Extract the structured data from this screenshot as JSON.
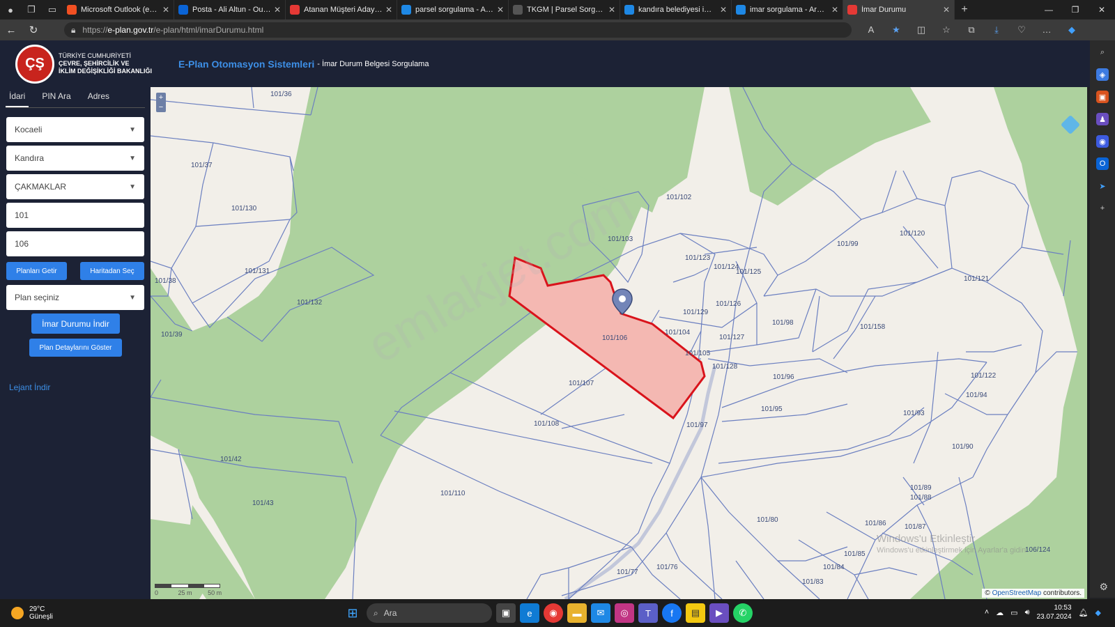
{
  "browser": {
    "tabs": [
      {
        "title": "Microsoft Outlook (eski a",
        "color": "#f25022"
      },
      {
        "title": "Posta - Ali Altun - Outlo",
        "color": "#0a64d6"
      },
      {
        "title": "Atanan Müşteri Adayları",
        "color": "#e53935"
      },
      {
        "title": "parsel sorgulama - Aram",
        "color": "#1e88e5"
      },
      {
        "title": "TKGM | Parsel Sorgu Uyg",
        "color": "#555555"
      },
      {
        "title": "kandıra belediyesi imar d",
        "color": "#1e88e5"
      },
      {
        "title": "imar sorgulama - Arama",
        "color": "#1e88e5"
      },
      {
        "title": "İmar Durumu",
        "color": "#e53935"
      }
    ],
    "url_prefix": "https://",
    "url_host": "e-plan.gov.tr",
    "url_path": "/e-plan/html/imarDurumu.html"
  },
  "header": {
    "ministry_line1": "TÜRKİYE CUMHURİYETİ",
    "ministry_line2": "ÇEVRE, ŞEHİRCİLİK VE",
    "ministry_line3": "İKLİM DEĞİŞİKLİĞİ BAKANLIĞI",
    "app_title": "E-Plan Otomasyon Sistemleri",
    "app_subtitle": " - İmar Durum Belgesi Sorgulama"
  },
  "panel": {
    "tabs": [
      "İdari",
      "PIN Ara",
      "Adres"
    ],
    "province": "Kocaeli",
    "district": "Kandıra",
    "neighborhood": "ÇAKMAKLAR",
    "block": "101",
    "parcel": "106",
    "btn_get_plans": "Planları Getir",
    "btn_select_map": "Haritadan Seç",
    "plan_select": "Plan seçiniz",
    "btn_download": "İmar Durumu İndir",
    "btn_details": "Plan Detaylarını Göster",
    "legend_link": "Lejant İndir"
  },
  "map": {
    "selected_parcel": "101/106",
    "highlight_fill": "#f4b8b2",
    "highlight_stroke": "#d9131b",
    "forest_color": "#add19e",
    "line_color": "#6b7fc0",
    "parcel_labels": [
      "101/36",
      "101/37",
      "101/130",
      "101/131",
      "101/132",
      "101/38",
      "101/39",
      "101/42",
      "101/43",
      "101/110",
      "101/108",
      "101/107",
      "101/106",
      "101/103",
      "101/102",
      "101/123",
      "101/124",
      "101/125",
      "101/126",
      "101/129",
      "101/104",
      "101/105",
      "101/127",
      "101/128",
      "101/98",
      "101/96",
      "101/95",
      "101/97",
      "101/120",
      "101/99",
      "101/121",
      "101/158",
      "101/122",
      "101/94",
      "101/93",
      "101/90",
      "101/89",
      "101/88",
      "101/87",
      "101/86",
      "101/85",
      "101/84",
      "101/83",
      "101/80",
      "101/77",
      "101/76",
      "106/124"
    ],
    "watermark": "emlakjet.com",
    "attribution_prefix": "© ",
    "attribution_link": "OpenStreetMap",
    "attribution_suffix": " contributors.",
    "scale_labels": [
      "0",
      "25 m",
      "50 m"
    ],
    "activate_line1": "Windows'u Etkinleştir",
    "activate_line2": "Windows'u etkinleştirmek için Ayarlar'a gidin."
  },
  "taskbar": {
    "temperature": "29°C",
    "weather": "Güneşli",
    "search": "Ara",
    "time": "10:53",
    "date": "23.07.2024"
  }
}
